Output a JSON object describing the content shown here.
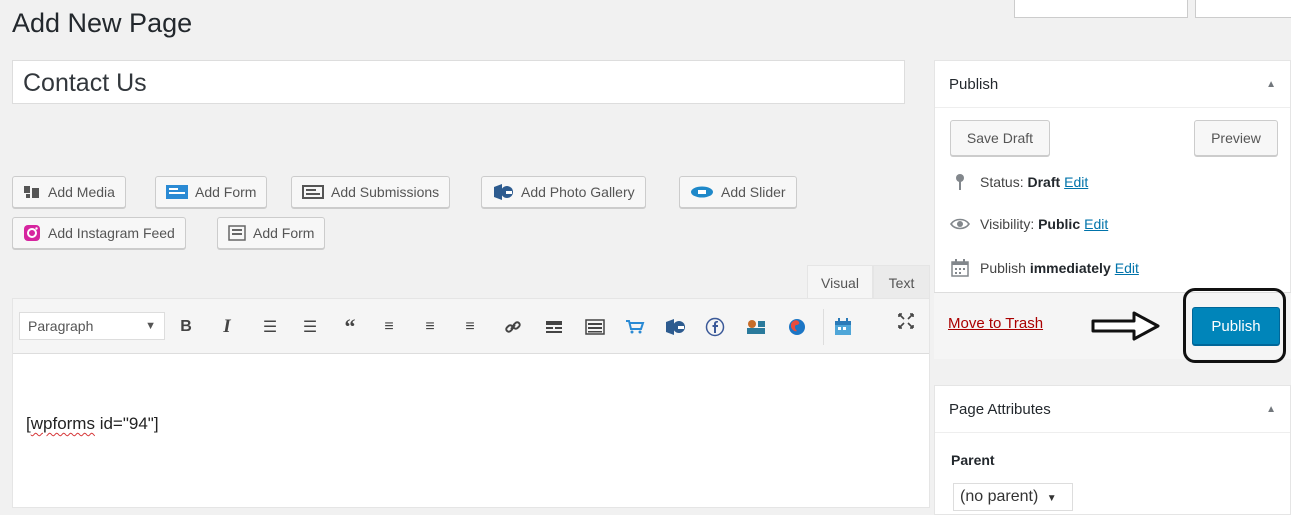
{
  "page": {
    "title": "Add New Page"
  },
  "post_title": {
    "value": "Contact Us"
  },
  "media_buttons": [
    {
      "label": "Add Media",
      "icon": "add-media-icon"
    },
    {
      "label": "Add Form",
      "icon": "form-icon"
    },
    {
      "label": "Add Submissions",
      "icon": "submissions-icon"
    },
    {
      "label": "Add Photo Gallery",
      "icon": "gallery-icon"
    },
    {
      "label": "Add Slider",
      "icon": "slider-icon"
    },
    {
      "label": "Add Instagram Feed",
      "icon": "instagram-icon"
    },
    {
      "label": "Add Form",
      "icon": "form-icon"
    }
  ],
  "editor": {
    "tabs": {
      "visual": "Visual",
      "text": "Text"
    },
    "format": "Paragraph",
    "toolbar_icons": [
      "bold-icon",
      "italic-icon",
      "bullet-list-icon",
      "numbered-list-icon",
      "blockquote-icon",
      "align-left-icon",
      "align-center-icon",
      "align-right-icon",
      "link-icon",
      "read-more-icon",
      "toolbar-toggle-icon",
      "cart-icon",
      "gallery-icon",
      "facebook-icon",
      "slider-icon",
      "map-pin-icon",
      "calendar-icon",
      "fullscreen-icon"
    ],
    "content_shortcode": "wpforms",
    "content_rest": " id=\"94\"]",
    "content_open": "["
  },
  "publish_box": {
    "title": "Publish",
    "save_draft": "Save Draft",
    "preview": "Preview",
    "status_label": "Status:",
    "status_value": "Draft",
    "visibility_label": "Visibility:",
    "visibility_value": "Public",
    "publish_label": "Publish",
    "publish_value": "immediately",
    "edit": "Edit",
    "move_to_trash": "Move to Trash",
    "publish_button": "Publish"
  },
  "page_attributes": {
    "title": "Page Attributes",
    "parent_label": "Parent",
    "parent_value": "(no parent)"
  },
  "colors": {
    "primary": "#0085ba",
    "link": "#0073aa",
    "trash": "#aa0000"
  }
}
